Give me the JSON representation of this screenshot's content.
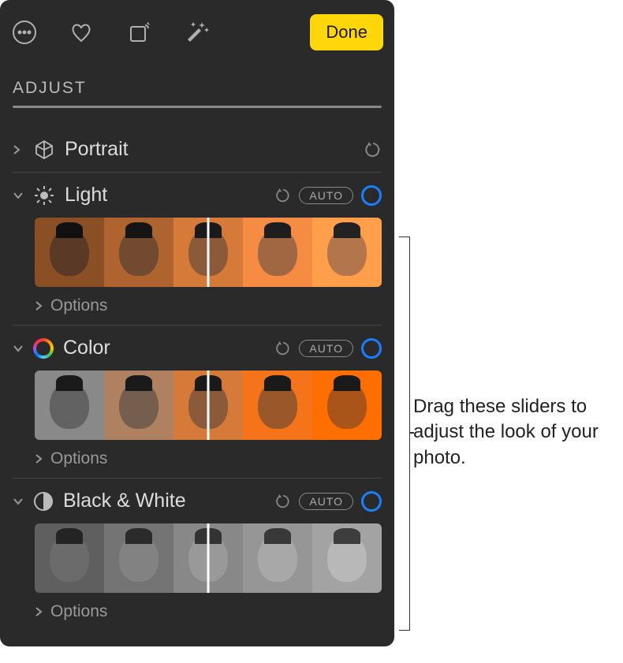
{
  "toolbar": {
    "done_label": "Done"
  },
  "adjust": {
    "title": "ADJUST"
  },
  "sections": {
    "portrait": {
      "label": "Portrait"
    },
    "light": {
      "label": "Light",
      "auto": "AUTO",
      "options": "Options"
    },
    "color": {
      "label": "Color",
      "auto": "AUTO",
      "options": "Options"
    },
    "bw": {
      "label": "Black & White",
      "auto": "AUTO",
      "options": "Options"
    }
  },
  "callout": {
    "text": "Drag these sliders to adjust the look of your photo."
  }
}
